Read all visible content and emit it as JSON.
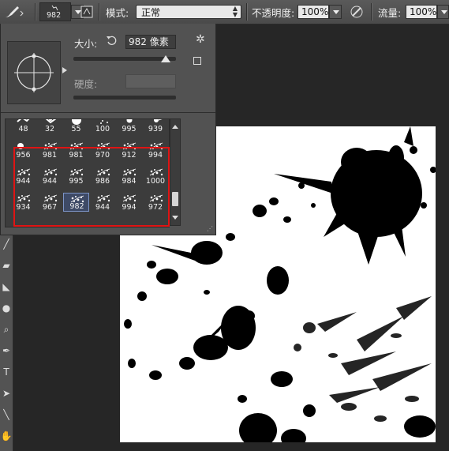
{
  "options_bar": {
    "tool_icon": "brush-tool-icon",
    "brush_size": "982",
    "toggle_icon": "brush-panel-toggle-icon",
    "mode_label": "模式:",
    "mode_value": "正常",
    "opacity_label": "不透明度:",
    "opacity_value": "100%",
    "pressure_icon": "pressure-opacity-icon",
    "flow_label": "流量:",
    "flow_value": "100%"
  },
  "brush_picker": {
    "size_label": "大小:",
    "reset_icon": "reset-size-icon",
    "size_value": "982 像素",
    "size_slider": 0.9,
    "hardness_label": "硬度:",
    "gear_icon": "gear-icon",
    "new_preset_icon": "new-preset-icon",
    "presets": [
      {
        "label": "48"
      },
      {
        "label": "32"
      },
      {
        "label": "55"
      },
      {
        "label": "100"
      },
      {
        "label": "995"
      },
      {
        "label": "939"
      },
      {
        "label": "956"
      },
      {
        "label": "981"
      },
      {
        "label": "981"
      },
      {
        "label": "970"
      },
      {
        "label": "912"
      },
      {
        "label": "994"
      },
      {
        "label": "944"
      },
      {
        "label": "944"
      },
      {
        "label": "995"
      },
      {
        "label": "986"
      },
      {
        "label": "984"
      },
      {
        "label": "1000"
      },
      {
        "label": "934"
      },
      {
        "label": "967"
      },
      {
        "label": "982"
      },
      {
        "label": "944"
      },
      {
        "label": "994"
      },
      {
        "label": "972"
      }
    ],
    "selected_index": 20,
    "scroll_position": 0.85
  },
  "colors": {
    "highlight_box": "#e01414",
    "canvas": "#ffffff",
    "selection": "#7d95c8"
  },
  "tools": [
    "brush-tool-icon",
    "eraser-tool-icon",
    "paint-bucket-icon",
    "dodge-tool-icon",
    "zoom-tool-icon",
    "pen-tool-icon",
    "type-tool-icon",
    "path-select-icon",
    "line-tool-icon",
    "hand-tool-icon"
  ]
}
